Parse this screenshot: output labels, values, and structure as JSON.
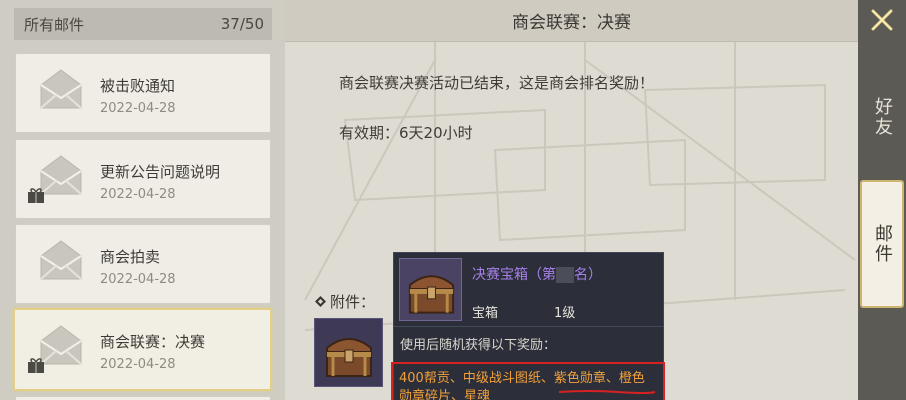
{
  "mailbox": {
    "header_label": "所有邮件",
    "count": "37/50"
  },
  "mails": [
    {
      "title": "被击败通知",
      "date": "2022-04-28",
      "has_gift": false,
      "selected": false
    },
    {
      "title": "更新公告问题说明",
      "date": "2022-04-28",
      "has_gift": true,
      "selected": false
    },
    {
      "title": "商会拍卖",
      "date": "2022-04-28",
      "has_gift": false,
      "selected": false
    },
    {
      "title": "商会联赛：决赛",
      "date": "2022-04-28",
      "has_gift": true,
      "selected": true
    }
  ],
  "detail": {
    "title": "商会联赛：决赛",
    "body": "商会联赛决赛活动已结束，这是商会排名奖励！",
    "validity": "有效期：6天20小时",
    "attachment_label": "附件："
  },
  "tooltip": {
    "name_prefix": "决赛宝箱（第",
    "name_suffix": "名）",
    "type": "宝箱",
    "level": "1级",
    "desc": "使用后随机获得以下奖励：",
    "rewards_line1_a": "400帮贡、中级战斗图纸、",
    "rewards_line1_b": "紫色勋章",
    "rewards_line1_c": "、",
    "rewards_line1_d": "橙色",
    "rewards_line2_a": "勋章碎片",
    "rewards_line2_b": "、",
    "rewards_line2_c": "星魂"
  },
  "rail": {
    "friends_label": "好友",
    "mail_label": "邮件"
  },
  "colors": {
    "accent_gold": "#e3cf86",
    "item_purple": "#a680e8",
    "reward_orange": "#f2a03a",
    "highlight_red": "#d72222"
  },
  "icons": {
    "mail": "envelope-icon",
    "gift": "gift-icon",
    "close": "close-x-icon",
    "attachment": "diamond-bullet-icon",
    "item": "treasure-chest-icon"
  }
}
